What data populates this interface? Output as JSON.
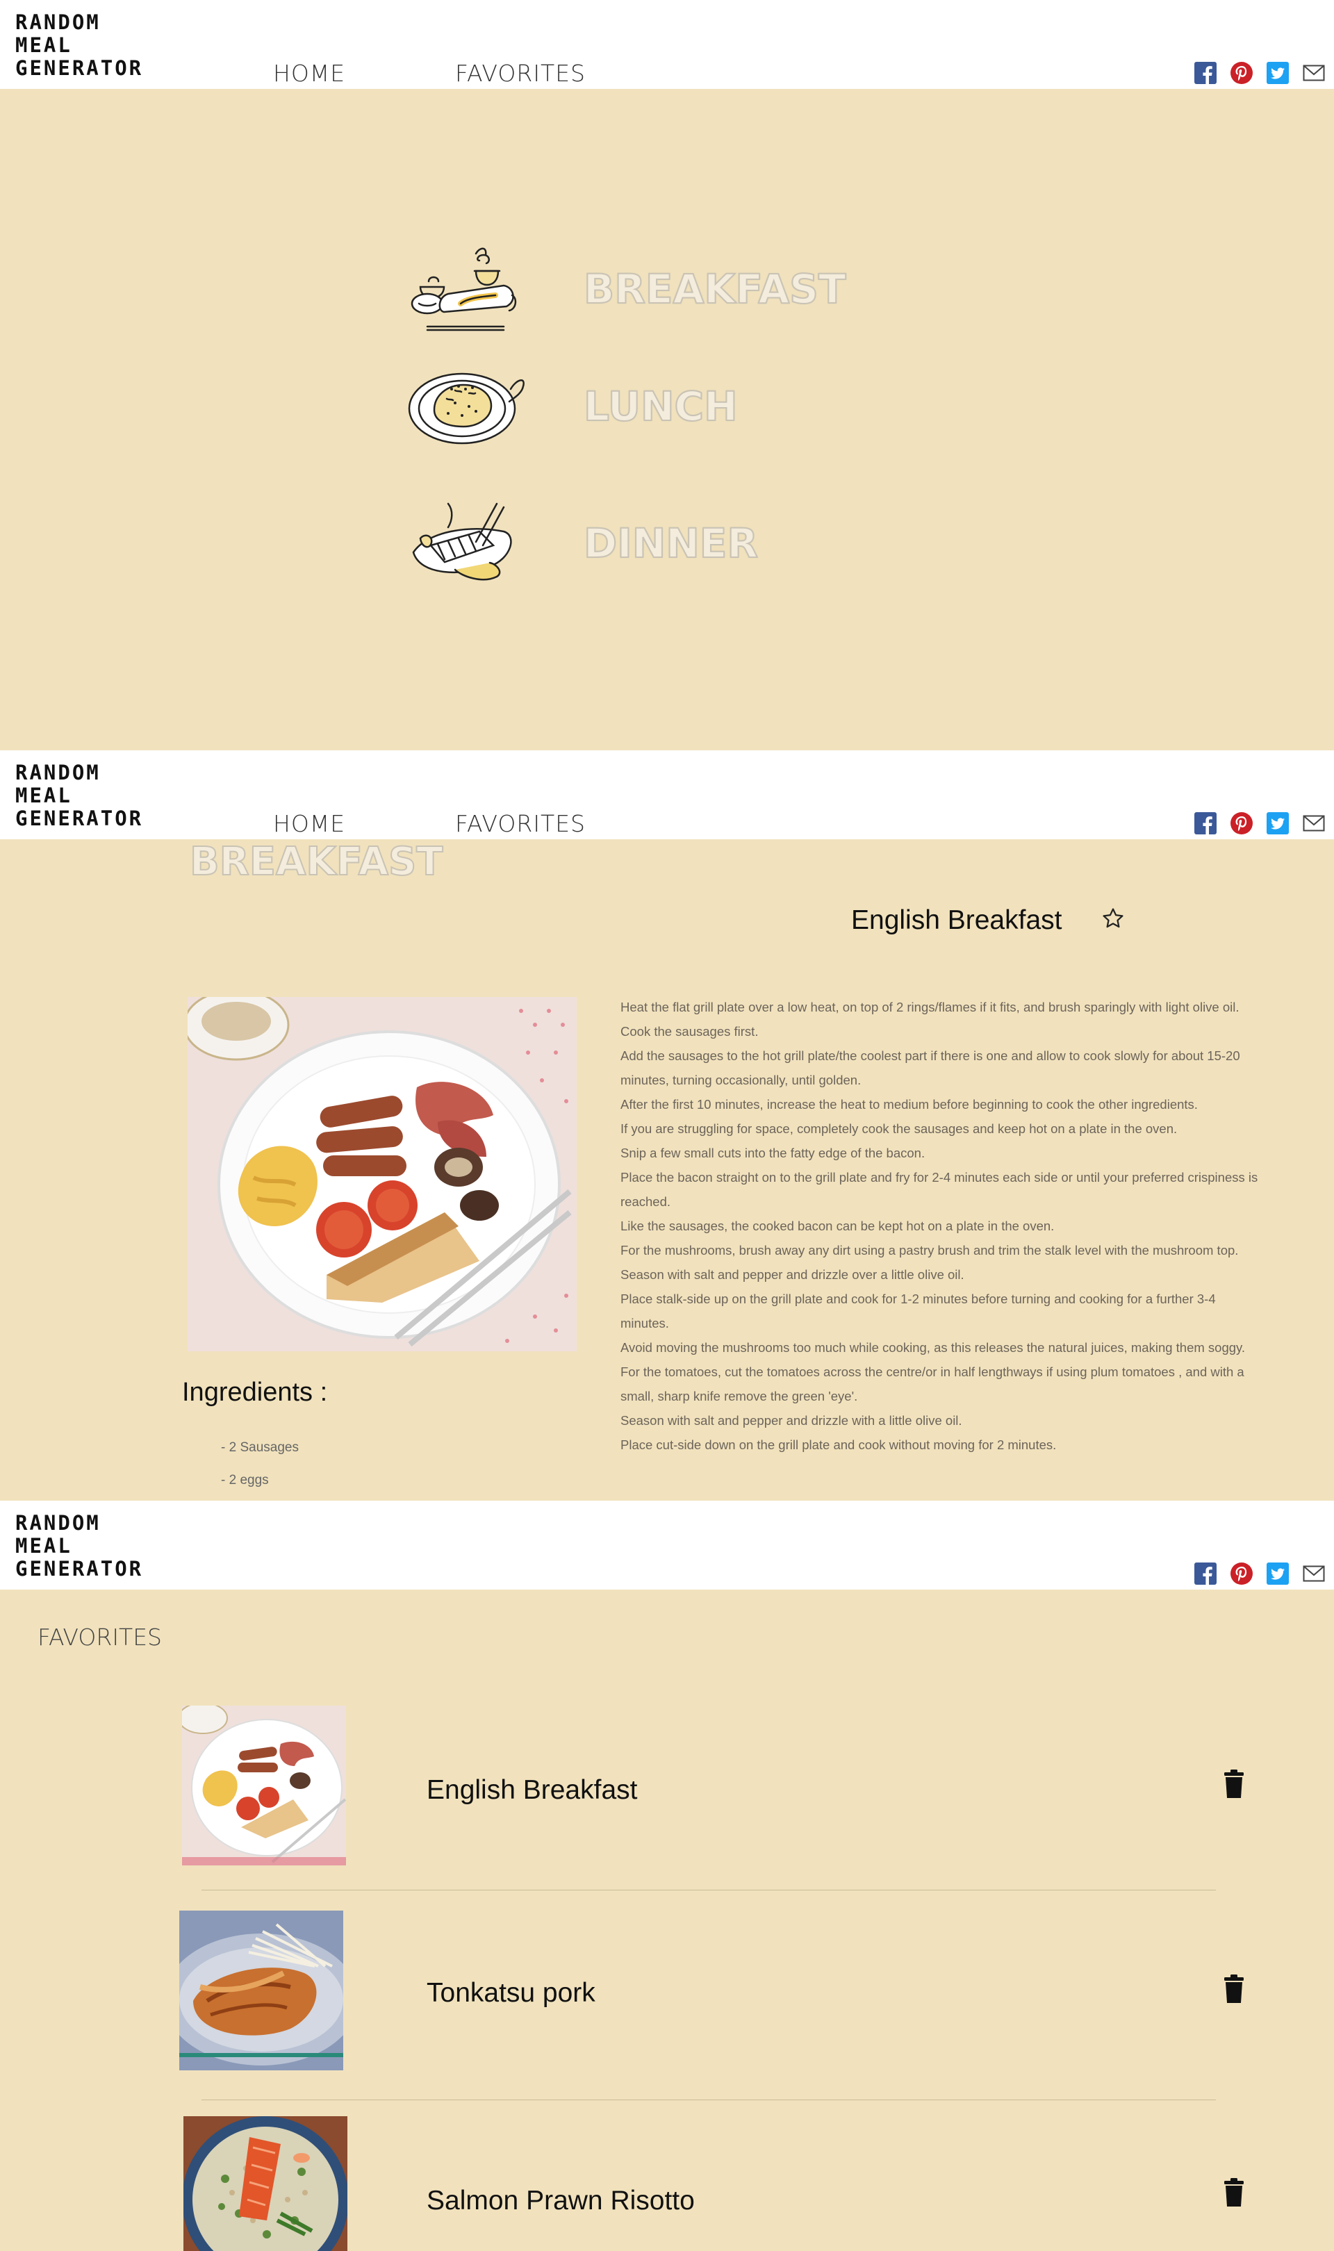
{
  "app": {
    "logo_lines": [
      "RANDOM",
      "MEAL",
      "GENERATOR"
    ],
    "nav": {
      "home": "HOME",
      "favorites": "FAVORITES"
    },
    "social": [
      "facebook-icon",
      "pinterest-icon",
      "twitter-icon",
      "mail-icon"
    ],
    "colors": {
      "background": "#f1e2bd",
      "header": "#ffffff",
      "facebook": "#3b5998",
      "pinterest": "#cb2027",
      "twitter": "#1da1f2"
    }
  },
  "menu": {
    "items": [
      {
        "label": "BREAKFAST",
        "icon": "breakfast-illustration"
      },
      {
        "label": "LUNCH",
        "icon": "lunch-illustration"
      },
      {
        "label": "DINNER",
        "icon": "dinner-illustration"
      }
    ]
  },
  "detail": {
    "section": "BREAKFAST",
    "recipe_name": "English Breakfast",
    "ingredients_title": "Ingredients :",
    "ingredients": [
      "- 2 Sausages",
      "- 2 eggs"
    ],
    "steps": [
      "Heat the flat grill plate over a low heat, on top of 2 rings/flames if it fits, and brush sparingly with light olive oil.",
      "Cook the sausages first.",
      "Add the sausages to the hot grill plate/the coolest part if there is one and allow to cook slowly for about 15-20 minutes, turning occasionally, until golden.",
      "After the first 10 minutes, increase the heat to medium before beginning to cook the other ingredients.",
      "If you are struggling for space, completely cook the sausages and keep hot on a plate in the oven.",
      "Snip a few small cuts into the fatty edge of the bacon.",
      "Place the bacon straight on to the grill plate and fry for 2-4 minutes each side or until your preferred crispiness is reached.",
      "Like the sausages, the cooked bacon can be kept hot on a plate in the oven.",
      "For the mushrooms, brush away any dirt using a pastry brush and trim the stalk level with the mushroom top.",
      "Season with salt and pepper and drizzle over a little olive oil.",
      "Place stalk-side up on the grill plate and cook for 1-2 minutes before turning and cooking for a further 3-4 minutes.",
      "Avoid moving the mushrooms too much while cooking, as this releases the natural juices, making them soggy.",
      "For the tomatoes, cut the tomatoes across the centre/or in half lengthways if using plum tomatoes , and with a small, sharp knife remove the green 'eye'.",
      "Season with salt and pepper and drizzle with a little olive oil.",
      "Place cut-side down on the grill plate and cook without moving for 2 minutes."
    ]
  },
  "favorites": {
    "heading": "FAVORITES",
    "items": [
      {
        "name": "English Breakfast"
      },
      {
        "name": "Tonkatsu pork"
      },
      {
        "name": "Salmon Prawn Risotto"
      }
    ]
  }
}
